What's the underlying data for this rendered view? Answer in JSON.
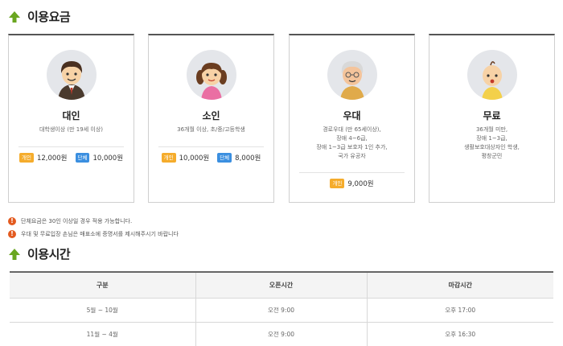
{
  "fees_section": {
    "title": "이용요금"
  },
  "cards": [
    {
      "name": "대인",
      "desc": [
        "대학생이상 (만 19세 이상)"
      ],
      "prices": [
        {
          "badge": "개인",
          "type": "individual",
          "amount": "12,000원"
        },
        {
          "badge": "단체",
          "type": "group",
          "amount": "10,000원"
        }
      ]
    },
    {
      "name": "소인",
      "desc": [
        "36개월 이상, 초/중/고등학생"
      ],
      "prices": [
        {
          "badge": "개인",
          "type": "individual",
          "amount": "10,000원"
        },
        {
          "badge": "단체",
          "type": "group",
          "amount": "8,000원"
        }
      ]
    },
    {
      "name": "우대",
      "desc": [
        "경로우대 (만 65세이상),",
        "장애 4~6급,",
        "장애 1~3급 보호자 1인 추가,",
        "국가 유공자"
      ],
      "prices": [
        {
          "badge": "개인",
          "type": "individual",
          "amount": "9,000원"
        }
      ]
    },
    {
      "name": "무료",
      "desc": [
        "36개월 미만,",
        "장애 1~3급,",
        "생활보호대상자인 학생,",
        "평창군민"
      ],
      "prices": []
    }
  ],
  "notices": [
    "단체요금은 30인 이상일 경우 적용 가능합니다.",
    "우대 및 무료입장 손님은 매표소에 증명서를 제시해주시기 바랍니다"
  ],
  "hours_section": {
    "title": "이용시간"
  },
  "hours_table": {
    "headers": [
      "구분",
      "오픈시간",
      "마감시간"
    ],
    "rows": [
      [
        "5월 ~ 10월",
        "오전 9:00",
        "오후 17:00"
      ],
      [
        "11월 ~ 4월",
        "오전 9:00",
        "오후 16:30"
      ]
    ]
  },
  "colors": {
    "individual_badge": "#f5ac2c",
    "group_badge": "#3b8fe0",
    "notice_icon": "#e35a1f",
    "arrow": "#6aa620"
  },
  "icons": {
    "section_arrow": "green-up-arrow-icon",
    "notice": "exclamation-icon"
  }
}
